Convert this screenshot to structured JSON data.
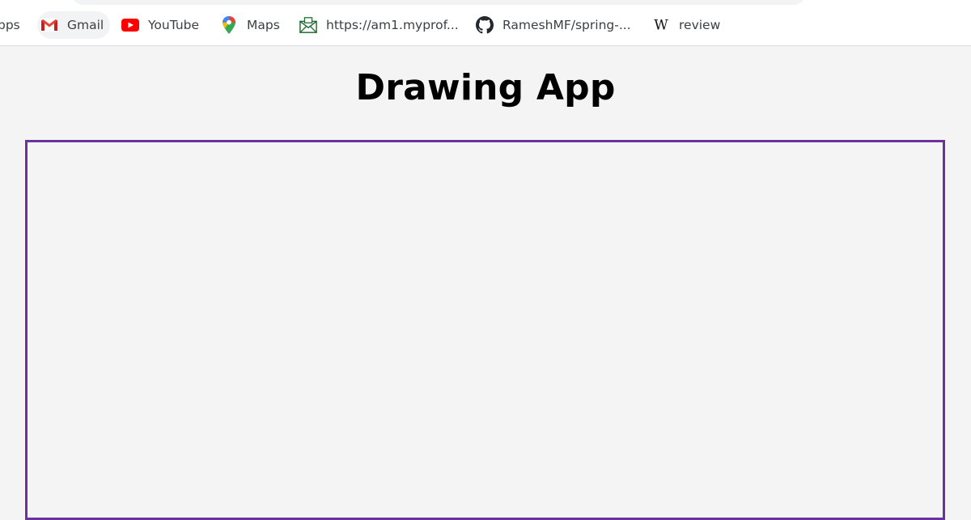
{
  "bookmarks": [
    {
      "label": "pps",
      "icon": "apps-grid-icon"
    },
    {
      "label": "Gmail",
      "icon": "gmail-icon"
    },
    {
      "label": "YouTube",
      "icon": "youtube-icon"
    },
    {
      "label": "Maps",
      "icon": "maps-pin-icon"
    },
    {
      "label": "https://am1.myprof...",
      "icon": "mail-envelope-icon"
    },
    {
      "label": "RameshMF/spring-...",
      "icon": "github-icon"
    },
    {
      "label": "review",
      "icon": "wikipedia-icon"
    }
  ],
  "page": {
    "title": "Drawing App"
  },
  "colors": {
    "page_background": "#f4f4f4",
    "canvas_border": "#6a329f",
    "youtube_red": "#ff0000",
    "gmail_red": "#ea4335"
  }
}
